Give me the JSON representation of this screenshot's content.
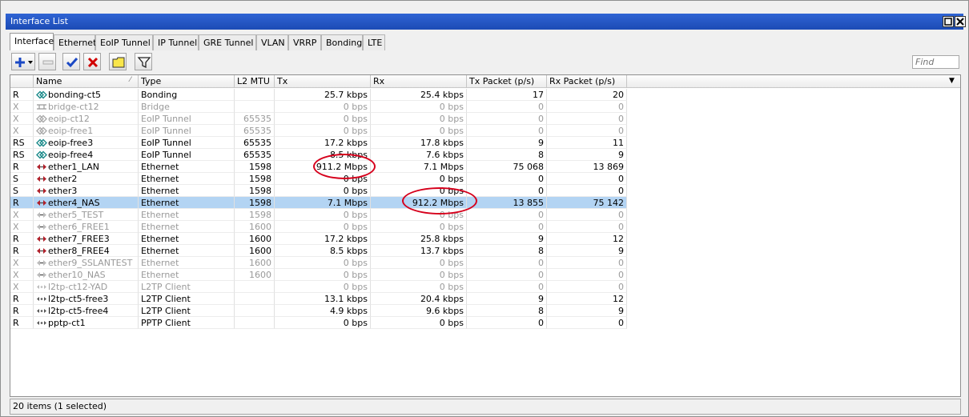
{
  "window": {
    "title": "Interface List"
  },
  "tabs": [
    "Interface",
    "Ethernet",
    "EoIP Tunnel",
    "IP Tunnel",
    "GRE Tunnel",
    "VLAN",
    "VRRP",
    "Bonding",
    "LTE"
  ],
  "toolbar": {
    "add_icon": "plus-icon",
    "remove_icon": "minus-icon",
    "enable_icon": "check-icon",
    "disable_icon": "x-icon",
    "comment_icon": "comment-icon",
    "filter_icon": "filter-icon"
  },
  "search": {
    "placeholder": "Find"
  },
  "columns": {
    "name": "Name",
    "type": "Type",
    "mtu": "L2 MTU",
    "tx": "Tx",
    "rx": "Rx",
    "tx_packet": "Tx Packet (p/s)",
    "rx_packet": "Rx Packet (p/s)"
  },
  "rows": [
    {
      "flag": "R",
      "name": "bonding-ct5",
      "type": "Bonding",
      "mtu": "",
      "tx": "25.7 kbps",
      "rx": "25.4 kbps",
      "txp": "17",
      "rxp": "20",
      "icon": "bonding",
      "disabled": false
    },
    {
      "flag": "X",
      "name": "bridge-ct12",
      "type": "Bridge",
      "mtu": "",
      "tx": "0 bps",
      "rx": "0 bps",
      "txp": "0",
      "rxp": "0",
      "icon": "bridge",
      "disabled": true
    },
    {
      "flag": "X",
      "name": "eoip-ct12",
      "type": "EoIP Tunnel",
      "mtu": "65535",
      "tx": "0 bps",
      "rx": "0 bps",
      "txp": "0",
      "rxp": "0",
      "icon": "bonding",
      "disabled": true
    },
    {
      "flag": "X",
      "name": "eoip-free1",
      "type": "EoIP Tunnel",
      "mtu": "65535",
      "tx": "0 bps",
      "rx": "0 bps",
      "txp": "0",
      "rxp": "0",
      "icon": "bonding",
      "disabled": true
    },
    {
      "flag": "RS",
      "name": "eoip-free3",
      "type": "EoIP Tunnel",
      "mtu": "65535",
      "tx": "17.2 kbps",
      "rx": "17.8 kbps",
      "txp": "9",
      "rxp": "11",
      "icon": "bonding",
      "disabled": false
    },
    {
      "flag": "RS",
      "name": "eoip-free4",
      "type": "EoIP Tunnel",
      "mtu": "65535",
      "tx": "8.5 kbps",
      "rx": "7.6 kbps",
      "txp": "8",
      "rxp": "9",
      "icon": "bonding",
      "disabled": false
    },
    {
      "flag": "R",
      "name": "ether1_LAN",
      "type": "Ethernet",
      "mtu": "1598",
      "tx": "911.2 Mbps",
      "rx": "7.1 Mbps",
      "txp": "75 068",
      "rxp": "13 869",
      "icon": "ethernet",
      "disabled": false
    },
    {
      "flag": "S",
      "name": "ether2",
      "type": "Ethernet",
      "mtu": "1598",
      "tx": "0 bps",
      "rx": "0 bps",
      "txp": "0",
      "rxp": "0",
      "icon": "ethernet",
      "disabled": false
    },
    {
      "flag": "S",
      "name": "ether3",
      "type": "Ethernet",
      "mtu": "1598",
      "tx": "0 bps",
      "rx": "0 bps",
      "txp": "0",
      "rxp": "0",
      "icon": "ethernet",
      "disabled": false
    },
    {
      "flag": "R",
      "name": "ether4_NAS",
      "type": "Ethernet",
      "mtu": "1598",
      "tx": "7.1 Mbps",
      "rx": "912.2 Mbps",
      "txp": "13 855",
      "rxp": "75 142",
      "icon": "ethernet",
      "disabled": false,
      "selected": true
    },
    {
      "flag": "X",
      "name": "ether5_TEST",
      "type": "Ethernet",
      "mtu": "1598",
      "tx": "0 bps",
      "rx": "0 bps",
      "txp": "0",
      "rxp": "0",
      "icon": "ethernet",
      "disabled": true
    },
    {
      "flag": "X",
      "name": "ether6_FREE1",
      "type": "Ethernet",
      "mtu": "1600",
      "tx": "0 bps",
      "rx": "0 bps",
      "txp": "0",
      "rxp": "0",
      "icon": "ethernet",
      "disabled": true
    },
    {
      "flag": "R",
      "name": "ether7_FREE3",
      "type": "Ethernet",
      "mtu": "1600",
      "tx": "17.2 kbps",
      "rx": "25.8 kbps",
      "txp": "9",
      "rxp": "12",
      "icon": "ethernet",
      "disabled": false
    },
    {
      "flag": "R",
      "name": "ether8_FREE4",
      "type": "Ethernet",
      "mtu": "1600",
      "tx": "8.5 kbps",
      "rx": "13.7 kbps",
      "txp": "8",
      "rxp": "9",
      "icon": "ethernet",
      "disabled": false
    },
    {
      "flag": "X",
      "name": "ether9_SSLANTEST",
      "type": "Ethernet",
      "mtu": "1600",
      "tx": "0 bps",
      "rx": "0 bps",
      "txp": "0",
      "rxp": "0",
      "icon": "ethernet",
      "disabled": true
    },
    {
      "flag": "X",
      "name": "ether10_NAS",
      "type": "Ethernet",
      "mtu": "1600",
      "tx": "0 bps",
      "rx": "0 bps",
      "txp": "0",
      "rxp": "0",
      "icon": "ethernet",
      "disabled": true
    },
    {
      "flag": "X",
      "name": "l2tp-ct12-YAD",
      "type": "L2TP Client",
      "mtu": "",
      "tx": "0 bps",
      "rx": "0 bps",
      "txp": "0",
      "rxp": "0",
      "icon": "tunnel",
      "disabled": true
    },
    {
      "flag": "R",
      "name": "l2tp-ct5-free3",
      "type": "L2TP Client",
      "mtu": "",
      "tx": "13.1 kbps",
      "rx": "20.4 kbps",
      "txp": "9",
      "rxp": "12",
      "icon": "tunnel",
      "disabled": false
    },
    {
      "flag": "R",
      "name": "l2tp-ct5-free4",
      "type": "L2TP Client",
      "mtu": "",
      "tx": "4.9 kbps",
      "rx": "9.6 kbps",
      "txp": "8",
      "rxp": "9",
      "icon": "tunnel",
      "disabled": false
    },
    {
      "flag": "R",
      "name": "pptp-ct1",
      "type": "PPTP Client",
      "mtu": "",
      "tx": "0 bps",
      "rx": "0 bps",
      "txp": "0",
      "rxp": "0",
      "icon": "tunnel",
      "disabled": false
    }
  ],
  "status": {
    "text": "20 items (1 selected)"
  },
  "colors": {
    "selected_row": "#b3d4f3",
    "annotation": "#d6001c",
    "title_bar": "#2f64d4"
  }
}
